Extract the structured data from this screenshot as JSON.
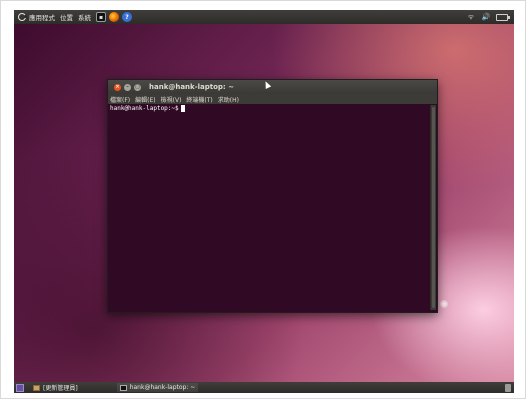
{
  "top_panel": {
    "menus": [
      "應用程式",
      "位置",
      "系統"
    ],
    "launchers": [
      {
        "icon": "terminal-launcher-icon"
      },
      {
        "icon": "firefox-icon"
      },
      {
        "icon": "help-icon",
        "glyph": "?"
      }
    ],
    "tray": {
      "network_glyph": "ᯤ",
      "volume_glyph": "🔊"
    }
  },
  "terminal": {
    "title": "hank@hank-laptop: ~",
    "menu": [
      "檔案(F)",
      "編輯(E)",
      "檢視(V)",
      "終端機(T)",
      "求助(H)"
    ],
    "prompt": "hank@hank-laptop:~$"
  },
  "bottom_panel": {
    "tasks": [
      {
        "label": "[更新管理員]",
        "icon": "package-icon"
      },
      {
        "label": "hank@hank-laptop: ~",
        "icon": "terminal-task-icon"
      }
    ]
  },
  "colors": {
    "terminal_bg": "#300a24",
    "panel_bg": "#3c3b37",
    "close_button": "#e95420"
  }
}
